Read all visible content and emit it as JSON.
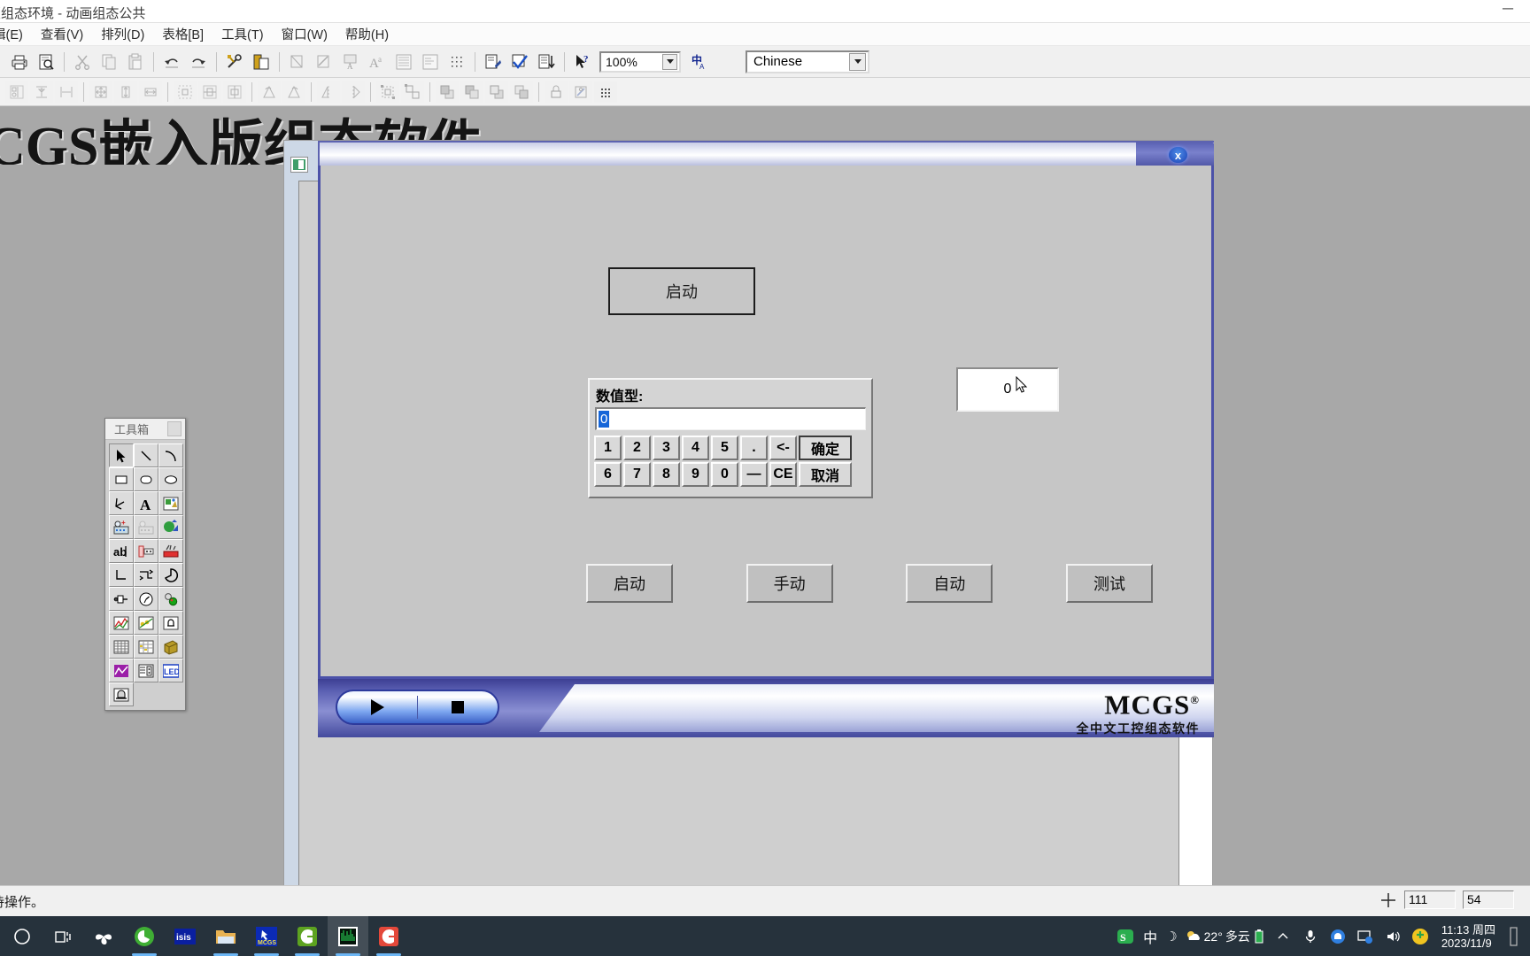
{
  "app": {
    "title": "版组态环境 - 动画组态公共",
    "minimize_label": "─"
  },
  "menubar": {
    "items": [
      {
        "label": "辑(E)",
        "name": "menu-edit"
      },
      {
        "label": "查看(V)",
        "name": "menu-view"
      },
      {
        "label": "排列(D)",
        "name": "menu-arrange"
      },
      {
        "label": "表格[B]",
        "name": "menu-table"
      },
      {
        "label": "工具(T)",
        "name": "menu-tools"
      },
      {
        "label": "窗口(W)",
        "name": "menu-window"
      },
      {
        "label": "帮助(H)",
        "name": "menu-help"
      }
    ]
  },
  "toolbar": {
    "zoom_value": "100%",
    "language_value": "Chinese",
    "row1_icons": [
      "print-icon",
      "print-preview-icon",
      "cut-icon",
      "copy-icon",
      "paste-icon",
      "undo-icon",
      "redo-icon",
      "tools-icon",
      "window-properties-icon",
      "fill-icon",
      "line-style-icon",
      "text-color-icon",
      "font-icon",
      "align-text-icon",
      "paragraph-icon",
      "grid-icon",
      "script-icon",
      "check-icon",
      "sort-icon",
      "help-pointer-icon"
    ],
    "row2_icons": [
      "align-bottom-icon",
      "align-middle-vert-icon",
      "align-center-horiz-icon",
      "size-both-icon",
      "size-height-icon",
      "size-width-icon",
      "center-page-icon",
      "space-vert-icon",
      "space-horiz-icon",
      "rotate-left-icon",
      "rotate-right-icon",
      "flip-vertical-icon",
      "flip-horizontal-icon",
      "group-icon",
      "ungroup-icon",
      "bring-front-icon",
      "send-back-icon",
      "forward-one-icon",
      "backward-one-icon",
      "lock-icon",
      "unlock-icon",
      "grid-snap-icon"
    ]
  },
  "background": {
    "banner_text": "CGS嵌入版组态软件"
  },
  "toolbox": {
    "title": "工具箱",
    "tools": [
      {
        "name": "tool-select-arrow",
        "icon": "arrow-pointer-icon",
        "active": true
      },
      {
        "name": "tool-line",
        "icon": "line-icon",
        "active": false
      },
      {
        "name": "tool-arc",
        "icon": "arc-icon",
        "active": false
      },
      {
        "name": "tool-rectangle",
        "icon": "rectangle-icon",
        "active": false
      },
      {
        "name": "tool-rounded-rect",
        "icon": "rounded-rect-icon",
        "active": false
      },
      {
        "name": "tool-ellipse",
        "icon": "ellipse-icon",
        "active": false
      },
      {
        "name": "tool-polygon",
        "icon": "polygon-icon",
        "active": false
      },
      {
        "name": "tool-text",
        "icon": "text-a-icon",
        "active": false
      },
      {
        "name": "tool-picture",
        "icon": "picture-icon",
        "active": false
      },
      {
        "name": "tool-insert-element",
        "icon": "insert-element-icon",
        "active": false
      },
      {
        "name": "tool-element-lib",
        "icon": "element-library-icon",
        "active": false
      },
      {
        "name": "tool-graphic-lib",
        "icon": "graphic-library-icon",
        "active": false
      },
      {
        "name": "tool-label",
        "icon": "label-abl-icon",
        "active": false
      },
      {
        "name": "tool-slider",
        "icon": "slider-input-icon",
        "active": false
      },
      {
        "name": "tool-alarm-strip",
        "icon": "alarm-strip-icon",
        "active": false
      },
      {
        "name": "tool-angle-line",
        "icon": "angle-line-icon",
        "active": false
      },
      {
        "name": "tool-step-line",
        "icon": "step-line-icon",
        "active": false
      },
      {
        "name": "tool-pie",
        "icon": "pie-arc-icon",
        "active": false
      },
      {
        "name": "tool-switch",
        "icon": "switch-icon",
        "active": false
      },
      {
        "name": "tool-meter",
        "icon": "gauge-meter-icon",
        "active": false
      },
      {
        "name": "tool-indicator",
        "icon": "indicator-light-icon",
        "active": false
      },
      {
        "name": "tool-realtime-chart",
        "icon": "realtime-chart-icon",
        "active": false
      },
      {
        "name": "tool-history-chart",
        "icon": "history-chart-icon",
        "active": false
      },
      {
        "name": "tool-alarm-bell",
        "icon": "alarm-bell-icon",
        "active": false
      },
      {
        "name": "tool-table",
        "icon": "table-grid-icon",
        "active": false
      },
      {
        "name": "tool-report",
        "icon": "report-grid-icon",
        "active": false
      },
      {
        "name": "tool-device-box",
        "icon": "device-box-icon",
        "active": false
      },
      {
        "name": "tool-curve",
        "icon": "curve-purple-icon",
        "active": false
      },
      {
        "name": "tool-recipe",
        "icon": "recipe-icon",
        "active": false
      },
      {
        "name": "tool-led",
        "icon": "led-icon",
        "active": false
      },
      {
        "name": "tool-bell-box",
        "icon": "bell-box-icon",
        "active": false
      }
    ]
  },
  "simulator": {
    "close_label": "x",
    "play_icon": "play-icon",
    "stop_icon": "stop-icon",
    "logo_text": "MCGS",
    "logo_reg": "®",
    "logo_sub": "全中文工控组态软件",
    "top_button": {
      "label": "启动",
      "name": "hmi-start-button-top"
    },
    "display_value": "0",
    "bottom_buttons": [
      {
        "label": "启动",
        "name": "hmi-button-start"
      },
      {
        "label": "手动",
        "name": "hmi-button-manual"
      },
      {
        "label": "自动",
        "name": "hmi-button-auto"
      },
      {
        "label": "测试",
        "name": "hmi-button-test"
      }
    ]
  },
  "keypad": {
    "label": "数值型:",
    "input_value": "0",
    "row1": [
      "1",
      "2",
      "3",
      "4",
      "5",
      ".",
      "<-"
    ],
    "row2": [
      "6",
      "7",
      "8",
      "9",
      "0",
      "—",
      "CE"
    ],
    "confirm_label": "确定",
    "cancel_label": "取消"
  },
  "statusbar": {
    "message": "待操作。",
    "coord_x": "111",
    "coord_y": "54",
    "crosshair_icon": "crosshair-icon"
  },
  "taskbar": {
    "icons": [
      {
        "name": "taskbar-start-cortana",
        "icon": "circle-o-icon",
        "active": false
      },
      {
        "name": "taskbar-task-view",
        "icon": "task-view-icon",
        "active": false
      },
      {
        "name": "taskbar-app-pinwheel",
        "icon": "pinwheel-icon",
        "active": false
      },
      {
        "name": "taskbar-browser-360",
        "icon": "green-e-browser-icon",
        "active": false
      },
      {
        "name": "taskbar-isis",
        "icon": "isis-icon",
        "active": false
      },
      {
        "name": "taskbar-file-explorer",
        "icon": "folder-icon",
        "active": false
      },
      {
        "name": "taskbar-mcgs",
        "icon": "mcgs-blue-icon",
        "active": false
      },
      {
        "name": "taskbar-app-green-c",
        "icon": "green-c-icon",
        "active": false
      },
      {
        "name": "taskbar-simulator",
        "icon": "waveform-icon",
        "active": true
      },
      {
        "name": "taskbar-app-red-c",
        "icon": "red-c-icon",
        "active": false
      }
    ],
    "tray": {
      "ime_sogou": "S",
      "ime_mode": "中",
      "ime_moon": "☽",
      "weather_temp": "22°",
      "weather_desc": "多云",
      "chevron": "⌃",
      "time": "11:13 周四",
      "date": "2023/11/9"
    }
  }
}
